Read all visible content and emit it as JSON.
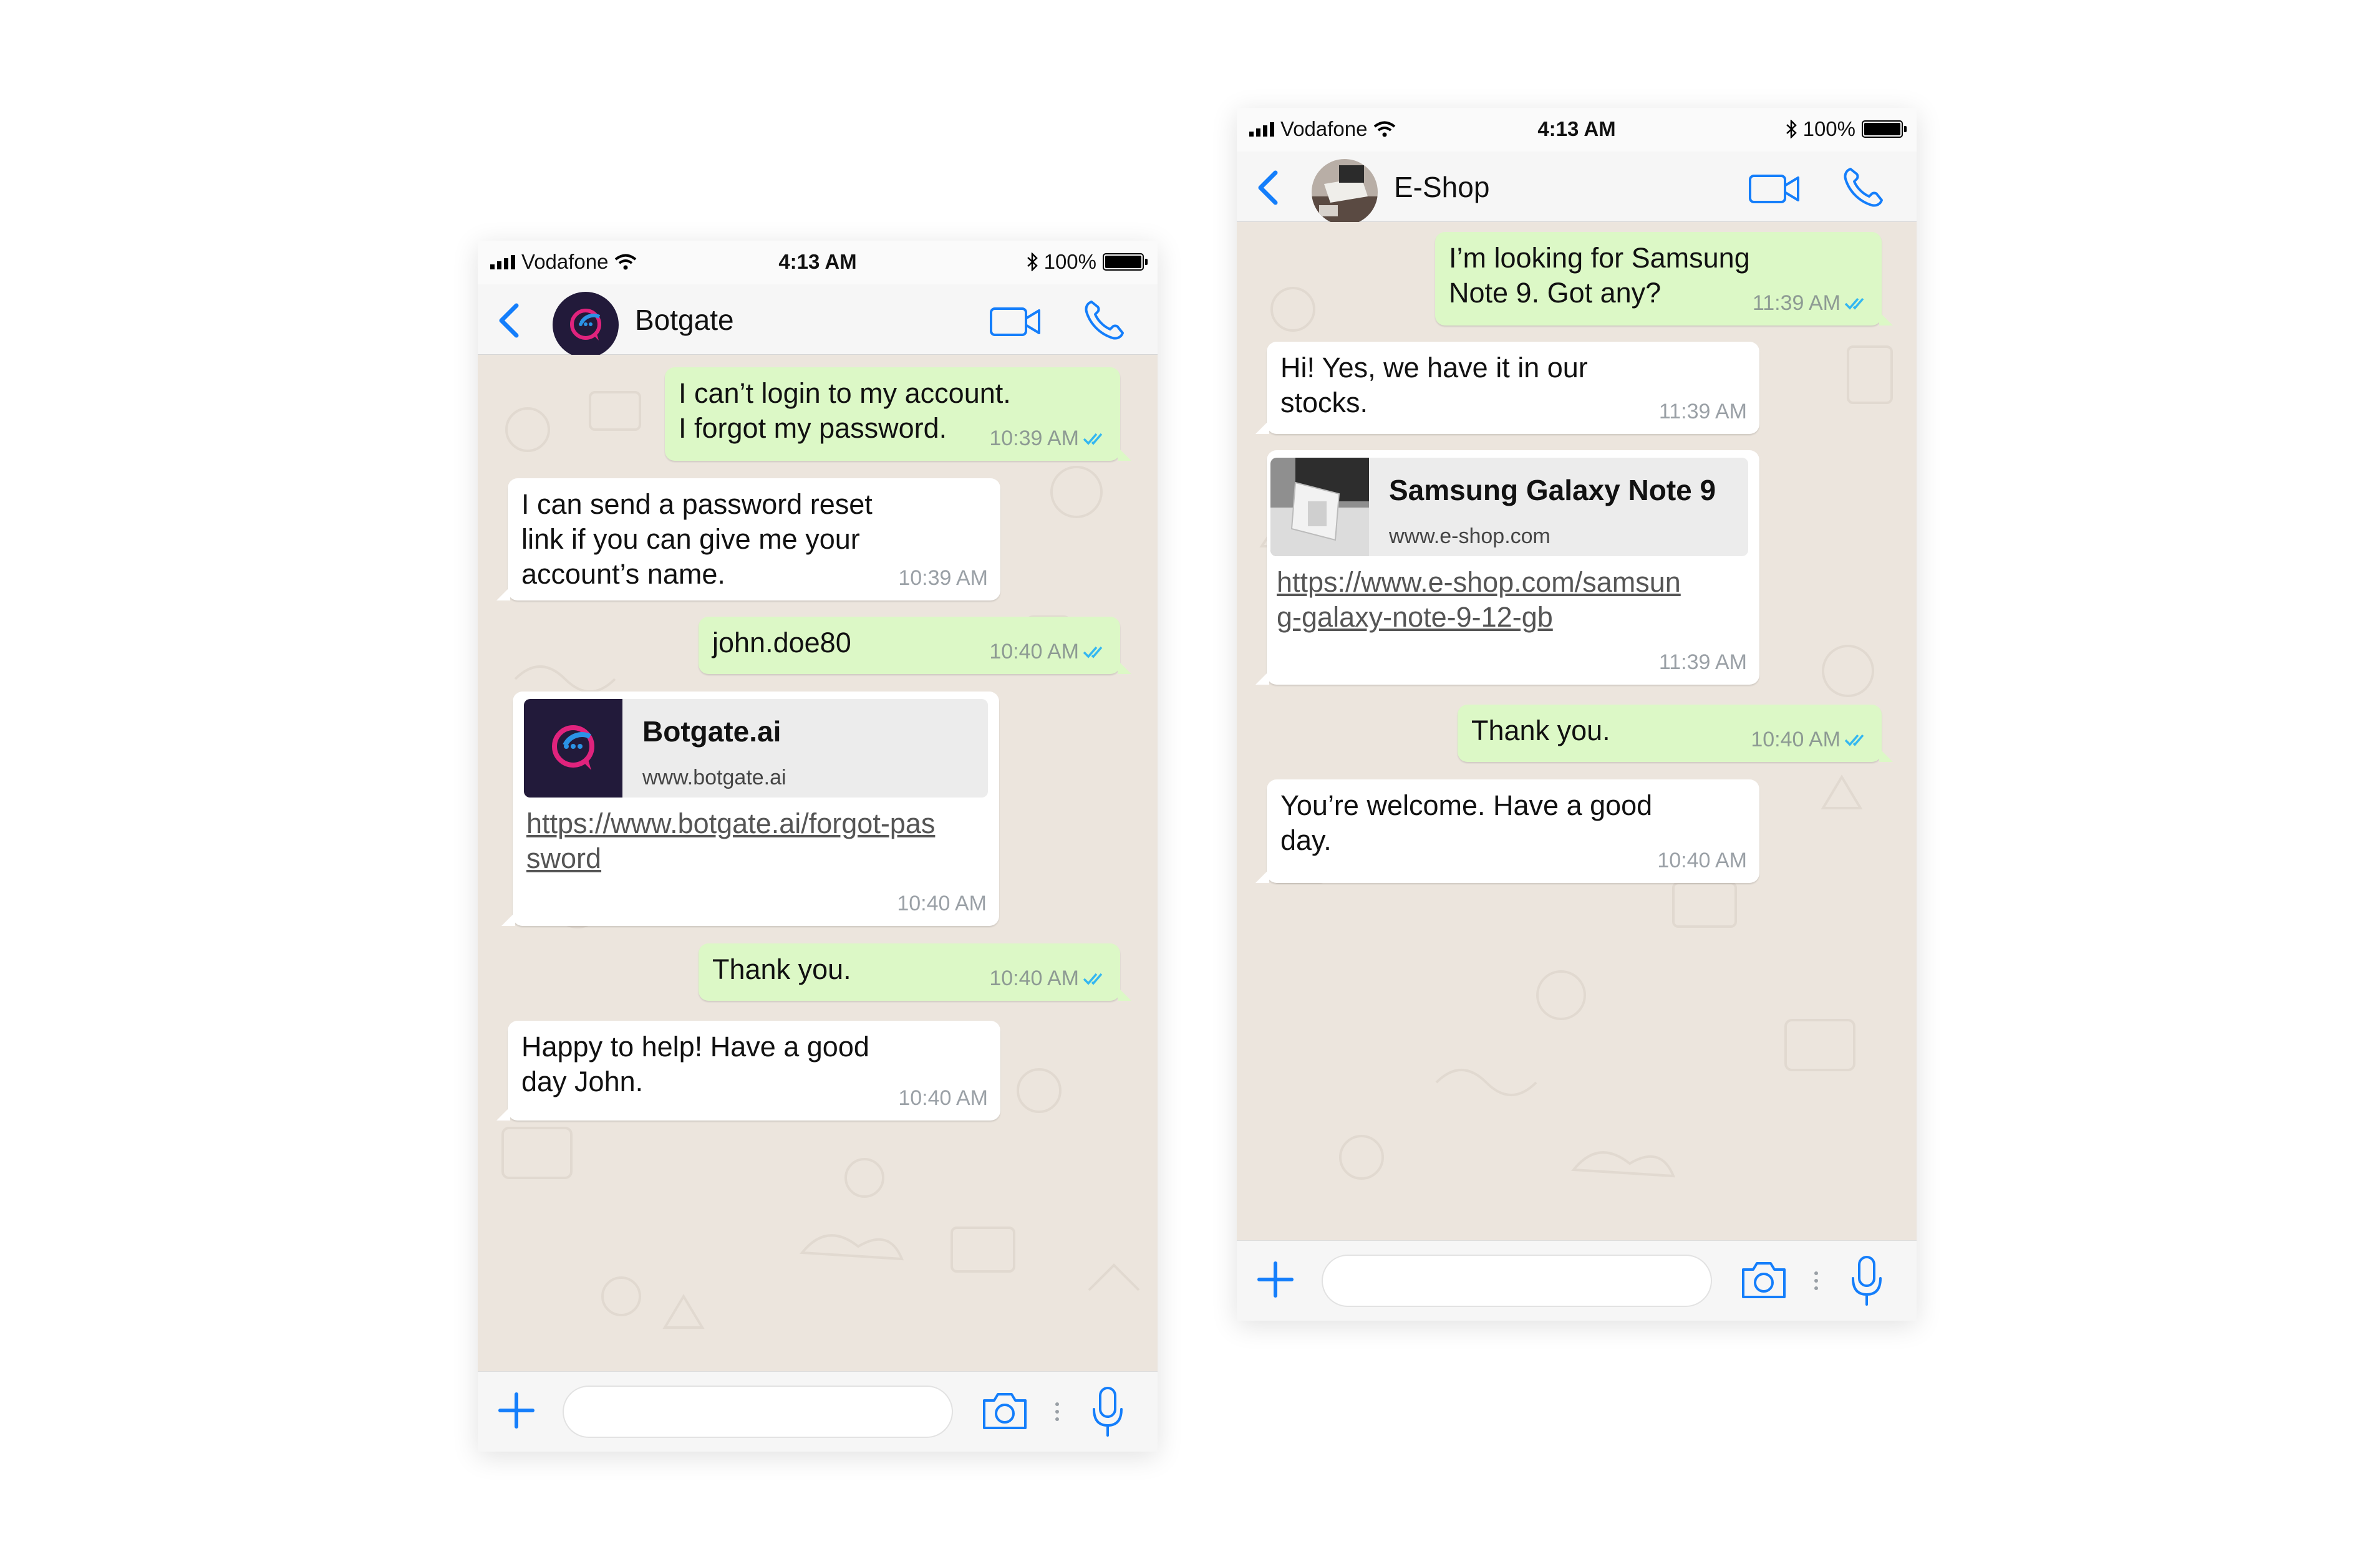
{
  "phones": [
    {
      "status": {
        "carrier": "Vodafone",
        "time": "4:13 AM",
        "battery": "100%"
      },
      "chat_name": "Botgate",
      "avatar_icon": "botgate-logo-icon",
      "messages": [
        {
          "dir": "out",
          "text": "I can’t login to my account.\nI forgot my password.",
          "time": "10:39 AM",
          "read": true
        },
        {
          "dir": "in",
          "text": "I can send a password reset\nlink if you can give me your\naccount’s name.",
          "time": "10:39 AM"
        },
        {
          "dir": "out",
          "text": "john.doe80",
          "time": "10:40 AM",
          "read": true
        },
        {
          "dir": "in",
          "type": "link",
          "link_title": "Botgate.ai",
          "link_domain": "www.botgate.ai",
          "url_text": "https://www.botgate.ai/forgot-pas\nsword",
          "time": "10:40 AM"
        },
        {
          "dir": "out",
          "text": "Thank you.",
          "time": "10:40 AM",
          "read": true
        },
        {
          "dir": "in",
          "text": "Happy to help! Have a good\nday John.",
          "time": "10:40 AM"
        }
      ]
    },
    {
      "status": {
        "carrier": "Vodafone",
        "time": "4:13 AM",
        "battery": "100%"
      },
      "chat_name": "E-Shop",
      "avatar_icon": "eshop-photo-avatar",
      "messages": [
        {
          "dir": "out",
          "text": "I’m looking for Samsung\nNote 9. Got any?",
          "time": "11:39 AM",
          "read": true
        },
        {
          "dir": "in",
          "text": "Hi! Yes, we have it in our\nstocks.",
          "time": "11:39 AM"
        },
        {
          "dir": "in",
          "type": "link",
          "link_title": "Samsung Galaxy Note 9",
          "link_domain": "www.e-shop.com",
          "url_text": "https://www.e-shop.com/samsun\ng-galaxy-note-9-12-gb",
          "time": "11:39 AM"
        },
        {
          "dir": "out",
          "text": "Thank you.",
          "time": "10:40 AM",
          "read": true
        },
        {
          "dir": "in",
          "text": "You’re welcome. Have a good\nday.",
          "time": "10:40 AM"
        }
      ]
    }
  ],
  "colors": {
    "accent": "#147efb",
    "outgoing_bubble": "#dcf8c6",
    "incoming_bubble": "#ffffff",
    "chat_background": "#ece5dd",
    "read_ticks": "#34b7f1"
  },
  "icons": [
    "back-chevron-icon",
    "video-call-icon",
    "phone-call-icon",
    "plus-icon",
    "camera-icon",
    "microphone-icon",
    "wifi-icon",
    "bluetooth-icon",
    "battery-icon",
    "signal-icon"
  ]
}
